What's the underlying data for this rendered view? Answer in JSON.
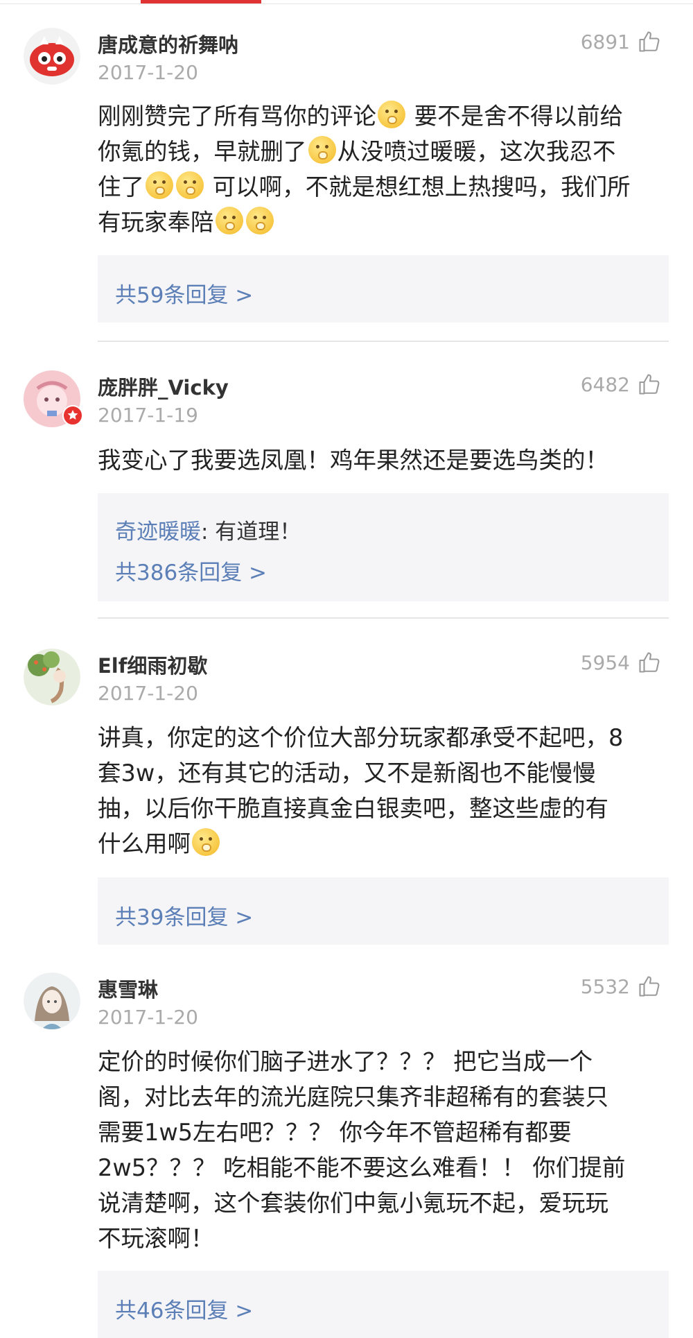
{
  "comments": [
    {
      "username": "唐成意的祈舞呐",
      "date": "2017-1-20",
      "likes": "6891",
      "content_lines": [
        [
          "刚刚赞完了所有骂你的评论",
          "[emoji]",
          " 要不是舍不得以前给"
        ],
        [
          "你氪的钱，早就删了",
          "[emoji]",
          "从没喷过暖暖，这次我忍不"
        ],
        [
          "住了",
          "[emoji]",
          "[emoji]",
          " 可以啊，不就是想红想上热搜吗，我们所"
        ],
        [
          "有玩家奉陪",
          "[emoji]",
          "[emoji]"
        ]
      ],
      "reply_preview": null,
      "replies_label": "共59条回复 >"
    },
    {
      "username": "庞胖胖_Vicky",
      "date": "2017-1-19",
      "likes": "6482",
      "content_lines": [
        [
          "我变心了我要选凤凰！鸡年果然还是要选鸟类的！"
        ]
      ],
      "reply_preview": {
        "author": "奇迹暖暖",
        "text": ": 有道理！"
      },
      "replies_label": "共386条回复 >"
    },
    {
      "username": "Elf细雨初歇",
      "date": "2017-1-20",
      "likes": "5954",
      "content_lines": [
        [
          "讲真，你定的这个价位大部分玩家都承受不起吧，8"
        ],
        [
          "套3w，还有其它的活动，又不是新阁也不能慢慢"
        ],
        [
          "抽，以后你干脆直接真金白银卖吧，整这些虚的有"
        ],
        [
          "什么用啊",
          "[emoji]"
        ]
      ],
      "reply_preview": null,
      "replies_label": "共39条回复 >"
    },
    {
      "username": "惠雪琳",
      "date": "2017-1-20",
      "likes": "5532",
      "content_lines": [
        [
          "定价的时候你们脑子进水了？？？ 把它当成一个"
        ],
        [
          "阁，对比去年的流光庭院只集齐非超稀有的套装只"
        ],
        [
          "需要1w5左右吧？？？ 你今年不管超稀有都要"
        ],
        [
          "2w5？？？ 吃相能不能不要这么难看！！ 你们提前"
        ],
        [
          "说清楚啊，这个套装你们中氪小氪玩不起，爱玩玩"
        ],
        [
          "不玩滚啊！"
        ]
      ],
      "reply_preview": null,
      "replies_label": "共46条回复 >"
    }
  ],
  "colors": {
    "accent_red": "#e03434",
    "link_blue": "#5b7fb6",
    "meta_gray": "#aaaaaa",
    "reply_bg": "#f5f5f7"
  }
}
